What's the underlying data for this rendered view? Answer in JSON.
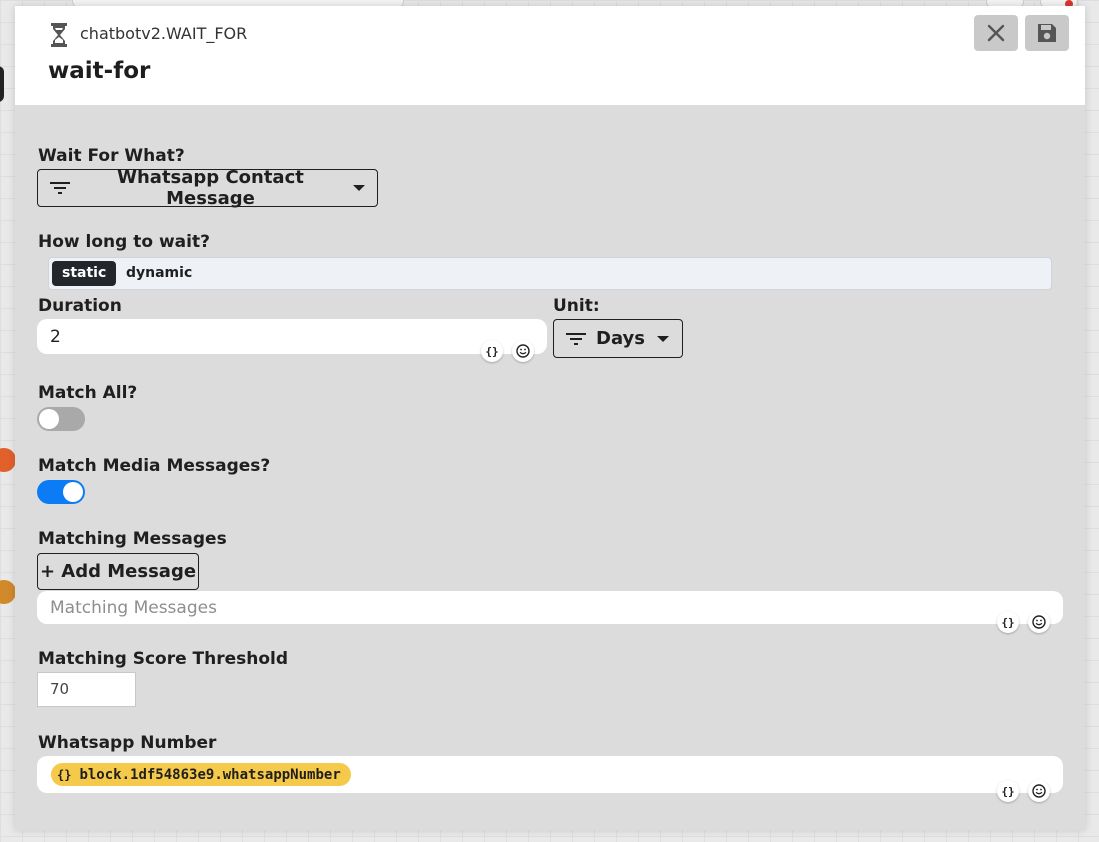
{
  "header": {
    "node_type": "chatbotv2.WAIT_FOR",
    "node_title": "wait-for"
  },
  "wait_for": {
    "label": "Wait For What?",
    "selected": "Whatsapp Contact Message"
  },
  "how_long": {
    "label": "How long to wait?",
    "options": [
      "static",
      "dynamic"
    ],
    "active": "static"
  },
  "duration": {
    "label": "Duration",
    "value": "2"
  },
  "unit": {
    "label": "Unit:",
    "selected": "Days"
  },
  "match_all": {
    "label": "Match All?",
    "enabled": false
  },
  "match_media": {
    "label": "Match Media Messages?",
    "enabled": true
  },
  "matching_messages": {
    "label": "Matching Messages",
    "add_button": "+ Add Message",
    "placeholder": "Matching Messages"
  },
  "threshold": {
    "label": "Matching Score Threshold",
    "value": "70"
  },
  "whatsapp_number": {
    "label": "Whatsapp Number",
    "variable": "block.1df54863e9.whatsappNumber"
  },
  "insert_variable_glyph": "{}",
  "colors": {
    "toggle_on": "#0b7cf6",
    "toggle_off": "#a9a9a9",
    "variable_chip": "#f5c949",
    "static_active": "#23272b"
  }
}
